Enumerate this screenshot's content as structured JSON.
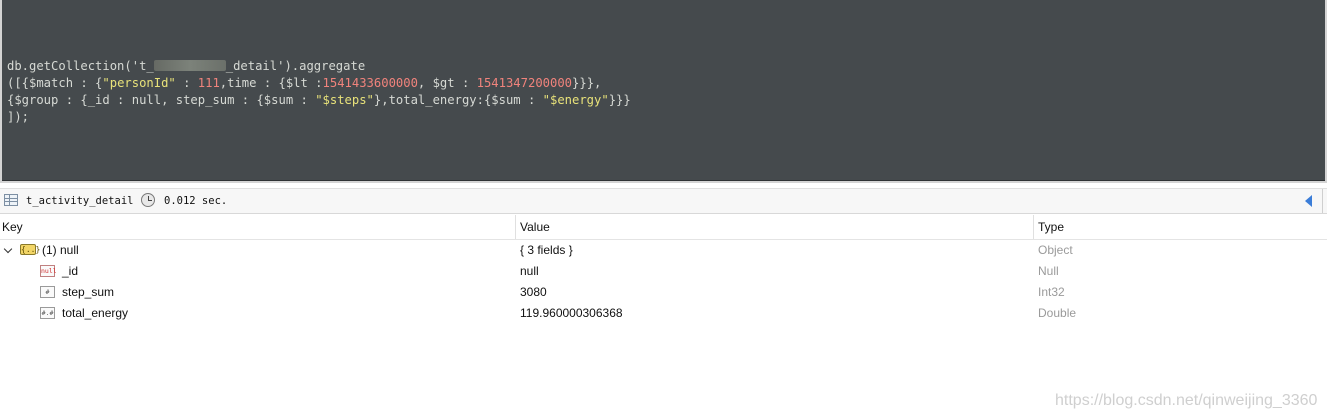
{
  "editor": {
    "lines": [
      [
        "db.getCollection('t_",
        "_detail').aggregate"
      ],
      "([{$match : {\"personId\" : 111,time : {$lt :1541433600000, $gt : 1541347200000}}},",
      "{$group : {_id : null, step_sum : {$sum : \"$steps\"},total_energy:{$sum : \"$energy\"}}}",
      "]);"
    ]
  },
  "status": {
    "collection": "t_activity_detail",
    "time": "0.012 sec."
  },
  "columns": {
    "key": "Key",
    "value": "Value",
    "type": "Type"
  },
  "rows": [
    {
      "key": "(1) null",
      "value": "{ 3 fields }",
      "type": "Object",
      "icon": "object-icon",
      "icon_text": "{..}"
    },
    {
      "key": "_id",
      "value": "null",
      "type": "Null",
      "icon": "null-icon",
      "icon_text": "null"
    },
    {
      "key": "step_sum",
      "value": "3080",
      "type": "Int32",
      "icon": "int-icon",
      "icon_text": "#"
    },
    {
      "key": "total_energy",
      "value": "119.960000306368",
      "type": "Double",
      "icon": "double-icon",
      "icon_text": "#.#"
    }
  ],
  "watermark": "https://blog.csdn.net/qinweijing_3360"
}
